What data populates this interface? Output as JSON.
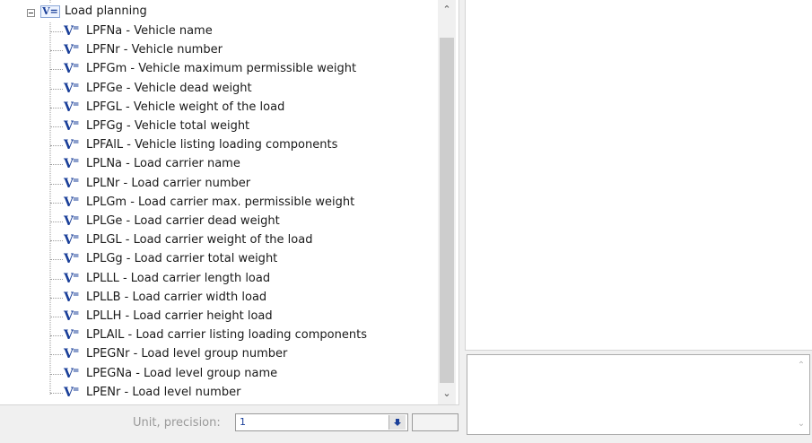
{
  "tree": {
    "root_label": "Load planning",
    "root_icon": "variable-group-icon",
    "root_icon_text": "V=",
    "item_icon": "variable-icon",
    "items": [
      {
        "label": "LPFNa - Vehicle name"
      },
      {
        "label": "LPFNr - Vehicle number"
      },
      {
        "label": "LPFGm - Vehicle maximum permissible weight"
      },
      {
        "label": "LPFGe - Vehicle dead weight"
      },
      {
        "label": "LPFGL - Vehicle weight of the load"
      },
      {
        "label": "LPFGg - Vehicle total weight"
      },
      {
        "label": "LPFAlL - Vehicle listing loading components"
      },
      {
        "label": "LPLNa - Load carrier name"
      },
      {
        "label": "LPLNr - Load carrier number"
      },
      {
        "label": "LPLGm - Load carrier max. permissible weight"
      },
      {
        "label": "LPLGe - Load carrier dead weight"
      },
      {
        "label": "LPLGL - Load carrier weight of the load"
      },
      {
        "label": "LPLGg - Load carrier total weight"
      },
      {
        "label": "LPLLL - Load carrier length load"
      },
      {
        "label": "LPLLB - Load carrier width load"
      },
      {
        "label": "LPLLH - Load carrier height load"
      },
      {
        "label": "LPLAlL - Load carrier listing loading components"
      },
      {
        "label": "LPEGNr - Load level group number"
      },
      {
        "label": "LPEGNa - Load level group name"
      },
      {
        "label": "LPENr - Load level number"
      }
    ]
  },
  "unit": {
    "label": "Unit, precision:",
    "value": "1",
    "precision_value": ""
  }
}
